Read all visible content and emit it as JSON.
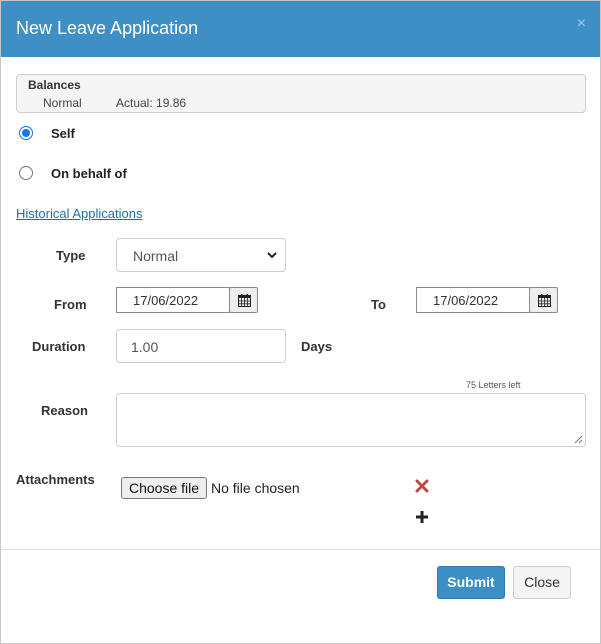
{
  "header": {
    "title": "New Leave Application",
    "close_glyph": "×"
  },
  "balances": {
    "title": "Balances",
    "leave_type": "Normal",
    "actual": "Actual:  19.86"
  },
  "options": {
    "self_label": "Self",
    "behalf_label": "On behalf of",
    "selected": "self"
  },
  "historical_link": "Historical Applications",
  "form": {
    "type_label": "Type",
    "type_value": "Normal",
    "from_label": "From",
    "from_value": "17/06/2022",
    "to_label": "To",
    "to_value": "17/06/2022",
    "duration_label": "Duration",
    "duration_value": "1.00",
    "duration_unit": "Days",
    "reason_label": "Reason",
    "letters_left": "75 Letters left",
    "attachments_label": "Attachments",
    "choose_file_label": "Choose file",
    "no_file_text": "No file chosen"
  },
  "footer": {
    "submit_label": "Submit",
    "close_label": "Close"
  },
  "colors": {
    "header": "#3d8fc6",
    "remove": "#b94a48",
    "link": "#1f6fa6"
  },
  "icons": [
    "close-icon",
    "calendar-icon",
    "chevron-down-icon",
    "remove-icon",
    "plus-icon"
  ]
}
